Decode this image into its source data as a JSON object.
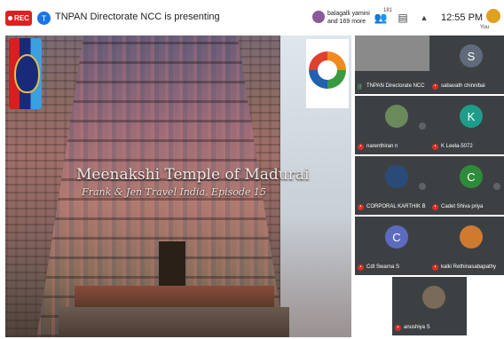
{
  "topbar": {
    "rec_label": "REC",
    "presenter_initial": "T",
    "presenter_text": "TNPAN Directorate NCC is presenting",
    "viewers_line1": "balagalli yamini",
    "viewers_line2": "and 169 more",
    "participants_count": "181",
    "time": "12:55 PM",
    "you_label": "You"
  },
  "slide": {
    "title": "Meenakshi Temple of Madurai",
    "subtitle": "Frank & Jen Travel India, Episode 15"
  },
  "participants": [
    {
      "name": "TNPAN Directorate NCC",
      "initial": "",
      "avatar_color": "#8a8a8a",
      "muted": false
    },
    {
      "name": "sabavath chinnibai",
      "initial": "S",
      "avatar_color": "#5f6b7a",
      "muted": true
    },
    {
      "name": "narenthiran n",
      "initial": "",
      "avatar_color": "#6a8a5a",
      "muted": true
    },
    {
      "name": "K Leela-5072",
      "initial": "K",
      "avatar_color": "#1e9e8a",
      "muted": true
    },
    {
      "name": "CORPORAL KARTHIK B",
      "initial": "",
      "avatar_color": "#2a4a7a",
      "muted": true
    },
    {
      "name": "Cadet Shiva priya",
      "initial": "C",
      "avatar_color": "#2e8b3a",
      "muted": true
    },
    {
      "name": "Cdt Swarna S",
      "initial": "C",
      "avatar_color": "#5c6bc0",
      "muted": true
    },
    {
      "name": "kalki Rethinasabapathy",
      "initial": "",
      "avatar_color": "#d07a30",
      "muted": true
    },
    {
      "name": "anushiya S",
      "initial": "",
      "avatar_color": "#7a6a5a",
      "muted": true
    }
  ],
  "colors": {
    "rec_red": "#e02020",
    "tile_bg": "#3c4043",
    "presenter_blue": "#1a73e8"
  }
}
